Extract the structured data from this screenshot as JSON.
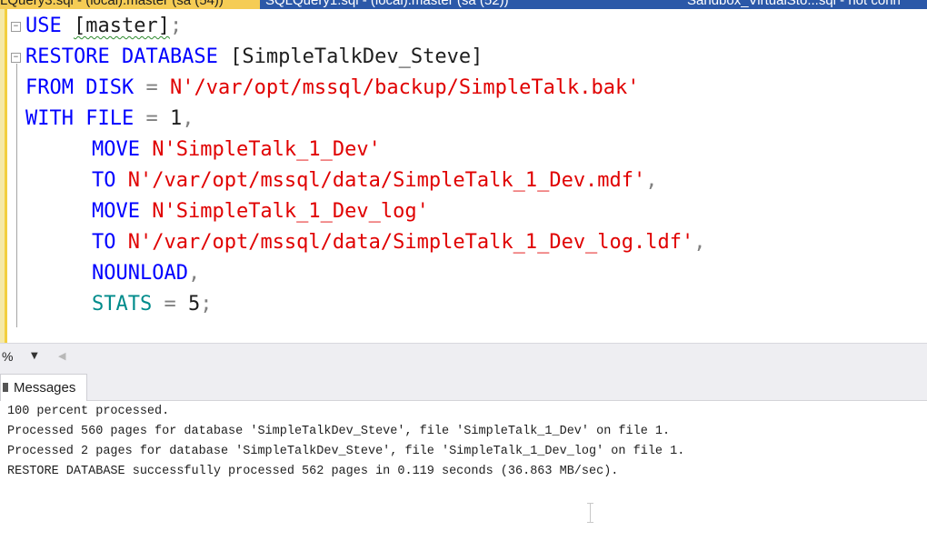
{
  "tabs": [
    {
      "label": "LQuery3.sql - (local).master (sa (54))"
    },
    {
      "label": "SQLQuery1.sql - (local).master (sa (52))"
    },
    {
      "label": "Sandbox_VirtualSto...sql - not conn"
    }
  ],
  "editor": {
    "line1": {
      "kw": "USE",
      "sp": " ",
      "name": "[master]",
      "semi": ";"
    },
    "line2": {
      "kw": "RESTORE DATABASE",
      "name": " [SimpleTalkDev_Steve]"
    },
    "line3": {
      "kw": "FROM DISK",
      "op": " = ",
      "str": "N'/var/opt/mssql/backup/SimpleTalk.bak'"
    },
    "line4": {
      "kw": "WITH FILE",
      "op": " = ",
      "num": "1",
      "comma": ","
    },
    "line5": {
      "kw": "MOVE",
      "str": " N'SimpleTalk_1_Dev'"
    },
    "line6": {
      "kw": "TO",
      "str": " N'/var/opt/mssql/data/SimpleTalk_1_Dev.mdf'",
      "comma": ","
    },
    "line7": {
      "kw": "MOVE",
      "str": " N'SimpleTalk_1_Dev_log'"
    },
    "line8": {
      "kw": "TO",
      "str": " N'/var/opt/mssql/data/SimpleTalk_1_Dev_log.ldf'",
      "comma": ","
    },
    "line9": {
      "kw": "NOUNLOAD",
      "comma": ","
    },
    "line10": {
      "kw": "STATS",
      "op": " = ",
      "num": "5",
      "semi": ";"
    }
  },
  "zoom": {
    "value": "%"
  },
  "results": {
    "tab_label": "Messages",
    "lines": [
      "100 percent processed.",
      "Processed 560 pages for database 'SimpleTalkDev_Steve', file 'SimpleTalk_1_Dev' on file 1.",
      "Processed 2 pages for database 'SimpleTalkDev_Steve', file 'SimpleTalk_1_Dev_log' on file 1.",
      "RESTORE DATABASE successfully processed 562 pages in 0.119 seconds (36.863 MB/sec)."
    ]
  }
}
